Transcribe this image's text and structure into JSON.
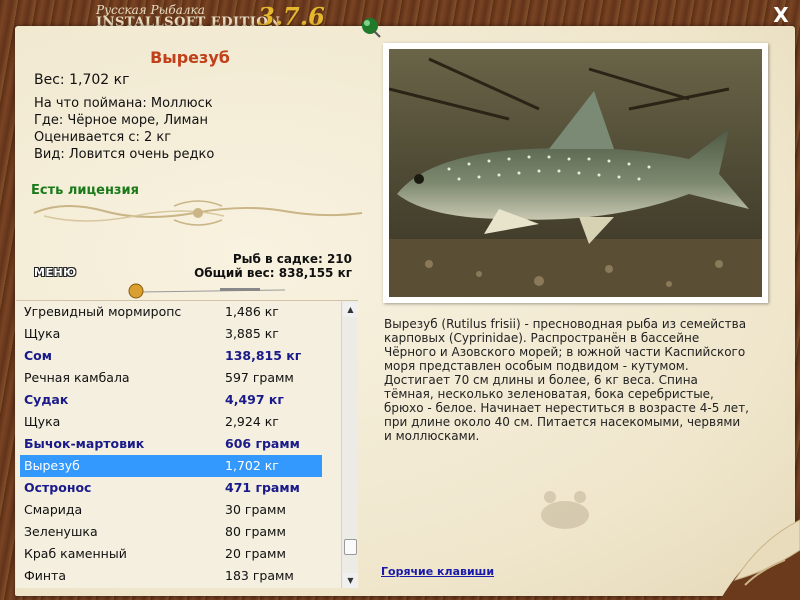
{
  "app": {
    "title_line1": "Русская Рыбалка",
    "title_line2": "INSTALLSOFT EDITION",
    "version": "3.7.6",
    "close_label": "X"
  },
  "fish": {
    "name": "Вырезуб",
    "weight": "Вес: 1,702 кг",
    "bait": "На что поймана: Моллюск",
    "location": "Где: Чёрное море, Лиман",
    "valued_from": "Оценивается с: 2 кг",
    "rarity": "Вид: Ловится очень редко",
    "license": "Есть лицензия"
  },
  "stats": {
    "fish_in_keepnet": "Рыб в садке: 210",
    "total_weight": "Общий вес: 838,155 кг"
  },
  "menu_label": "МЕНЮ",
  "list": [
    {
      "name": "Угревидный мормиропс",
      "weight": "1,486 кг",
      "bold": false
    },
    {
      "name": "Щука",
      "weight": "3,885 кг",
      "bold": false
    },
    {
      "name": "Сом",
      "weight": "138,815 кг",
      "bold": true
    },
    {
      "name": "Речная камбала",
      "weight": "597 грамм",
      "bold": false
    },
    {
      "name": "Судак",
      "weight": "4,497 кг",
      "bold": true
    },
    {
      "name": "Щука",
      "weight": "2,924 кг",
      "bold": false
    },
    {
      "name": "Бычок-мартовик",
      "weight": "606 грамм",
      "bold": true
    },
    {
      "name": "Вырезуб",
      "weight": "1,702 кг",
      "bold": false,
      "selected": true
    },
    {
      "name": "Остронос",
      "weight": "471 грамм",
      "bold": true
    },
    {
      "name": "Смарида",
      "weight": "30 грамм",
      "bold": false
    },
    {
      "name": "Зеленушка",
      "weight": "80 грамм",
      "bold": false
    },
    {
      "name": "Краб каменный",
      "weight": "20 грамм",
      "bold": false
    },
    {
      "name": "Финта",
      "weight": "183 грамм",
      "bold": false
    }
  ],
  "description": "Вырезуб (Rutilus frisii) - пресноводная рыба из семейства карповых (Cyprinidae). Распространён в бассейне Чёрного и Азовского морей; в южной части Каспийского моря представлен особым подвидом - кутумом. Достигает 70 см длины и более, 6 кг веса. Спина тёмная, несколько зеленоватая, бока серебристые, брюхо - белое. Начинает нереститься в возрасте 4-5 лет, при длине около 40 см. Питается насекомыми, червями и моллюсками.",
  "hotkeys_label": "Горячие клавиши",
  "colors": {
    "title_red": "#c0401a",
    "license_green": "#1a7a1a",
    "bold_blue": "#1a1a8a",
    "selection": "#3399ff",
    "version_gold": "#e6b830"
  }
}
